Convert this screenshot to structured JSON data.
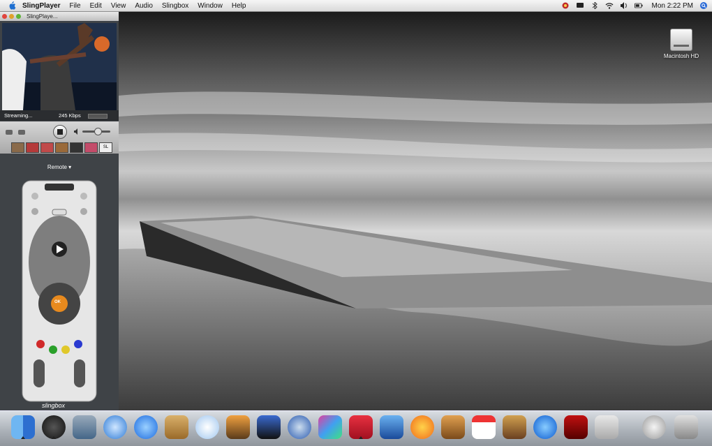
{
  "menubar": {
    "app_name": "SlingPlayer",
    "items": [
      "File",
      "Edit",
      "View",
      "Audio",
      "Slingbox",
      "Window",
      "Help"
    ],
    "clock": "Mon 2:22 PM"
  },
  "desktop": {
    "hd_label": "Macintosh HD"
  },
  "player": {
    "window_title": "SlingPlaye...",
    "status": "Streaming...",
    "bitrate": "245 Kbps",
    "remote_label": "Remote ▾",
    "remote_key_center": "OK",
    "brand": "slingbox",
    "volume_level": 0.55,
    "preset_last_label": "SL"
  },
  "dock": {
    "apps": [
      "finder",
      "dashboard",
      "preview",
      "safari",
      "ichat",
      "address-book",
      "itunes",
      "iphoto",
      "imovie",
      "idvd",
      "front-row",
      "garageband-sling",
      "feather",
      "flower",
      "garageband",
      "ical",
      "photo-booth",
      "quicktime",
      "red-app",
      "system-preferences",
      "mail",
      "trash"
    ]
  }
}
